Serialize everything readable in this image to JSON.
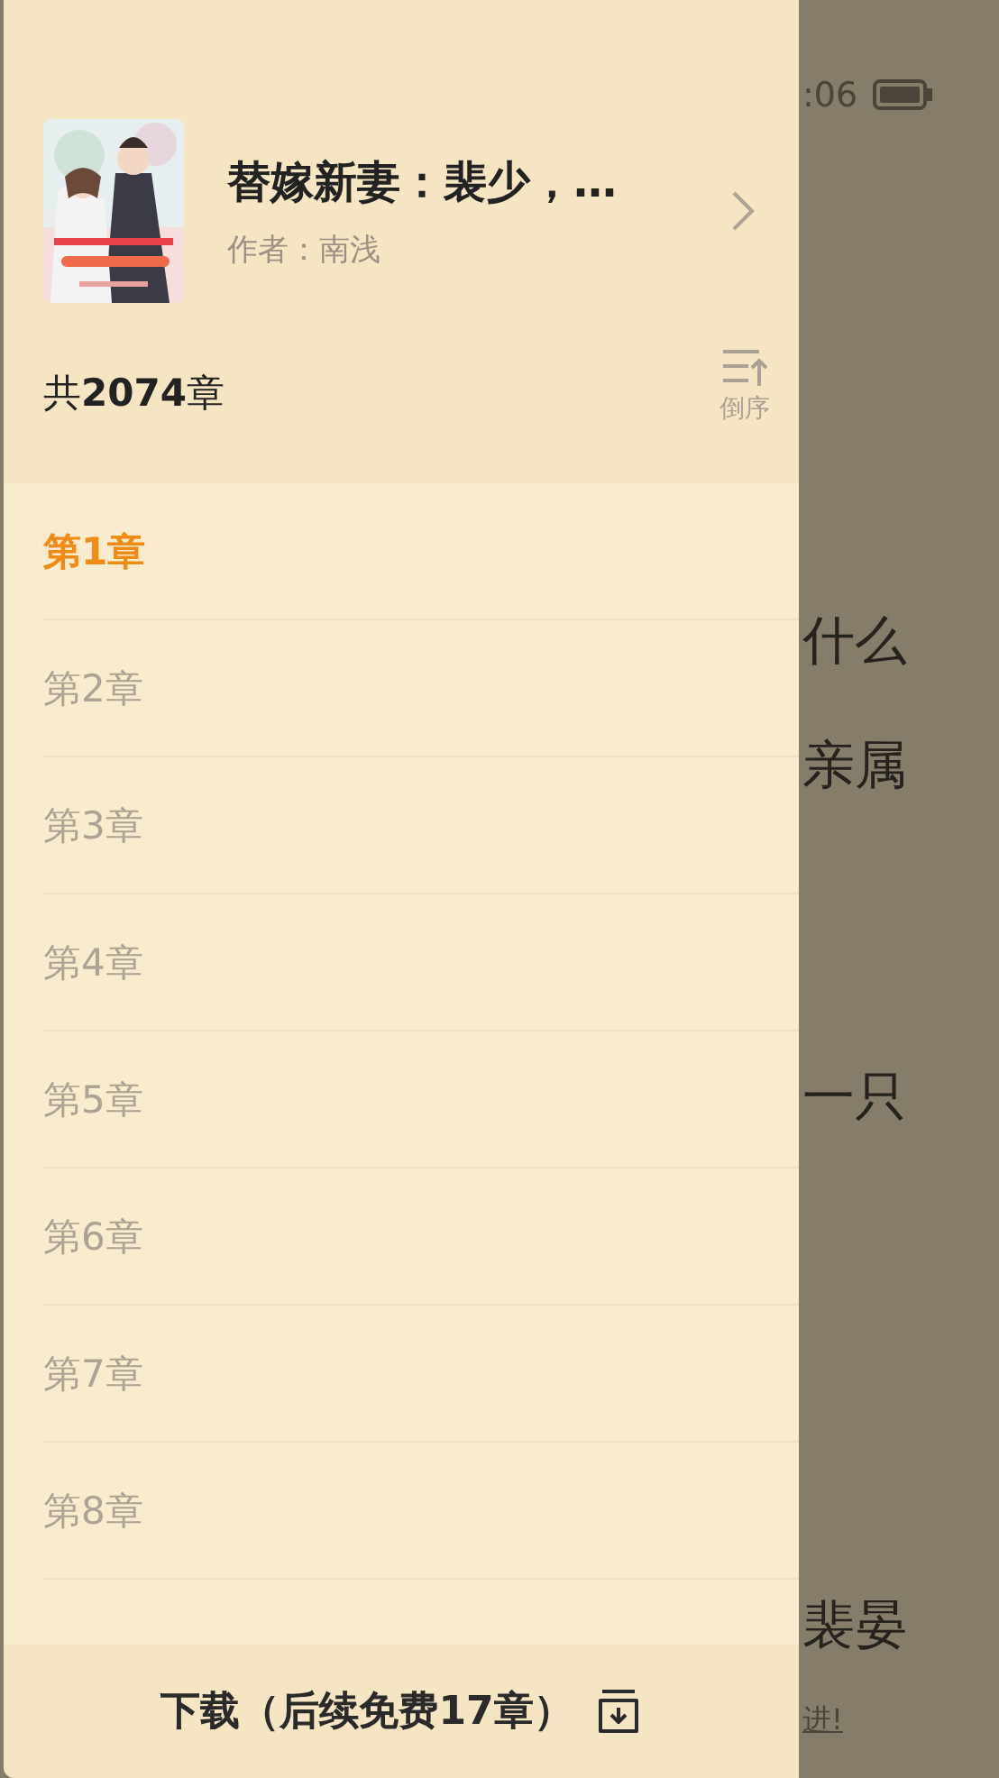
{
  "status_bar": {
    "time": ":06"
  },
  "background_text": [
    {
      "text": "什么"
    },
    {
      "text": "亲属"
    },
    {
      "text": "一只"
    },
    {
      "text": "裴晏"
    },
    {
      "text": "进!"
    }
  ],
  "book": {
    "title": "替嫁新妻：裴少，…",
    "author": "作者：南浅"
  },
  "chapter_count": {
    "prefix": "共",
    "number": "2074",
    "suffix": "章"
  },
  "sort_button": {
    "label": "倒序"
  },
  "chapters": [
    {
      "title": "第1章",
      "selected": true
    },
    {
      "title": "第2章",
      "selected": false
    },
    {
      "title": "第3章",
      "selected": false
    },
    {
      "title": "第4章",
      "selected": false
    },
    {
      "title": "第5章",
      "selected": false
    },
    {
      "title": "第6章",
      "selected": false
    },
    {
      "title": "第7章",
      "selected": false
    },
    {
      "title": "第8章",
      "selected": false
    }
  ],
  "download_button": {
    "label": "下载（后续免费17章）"
  }
}
